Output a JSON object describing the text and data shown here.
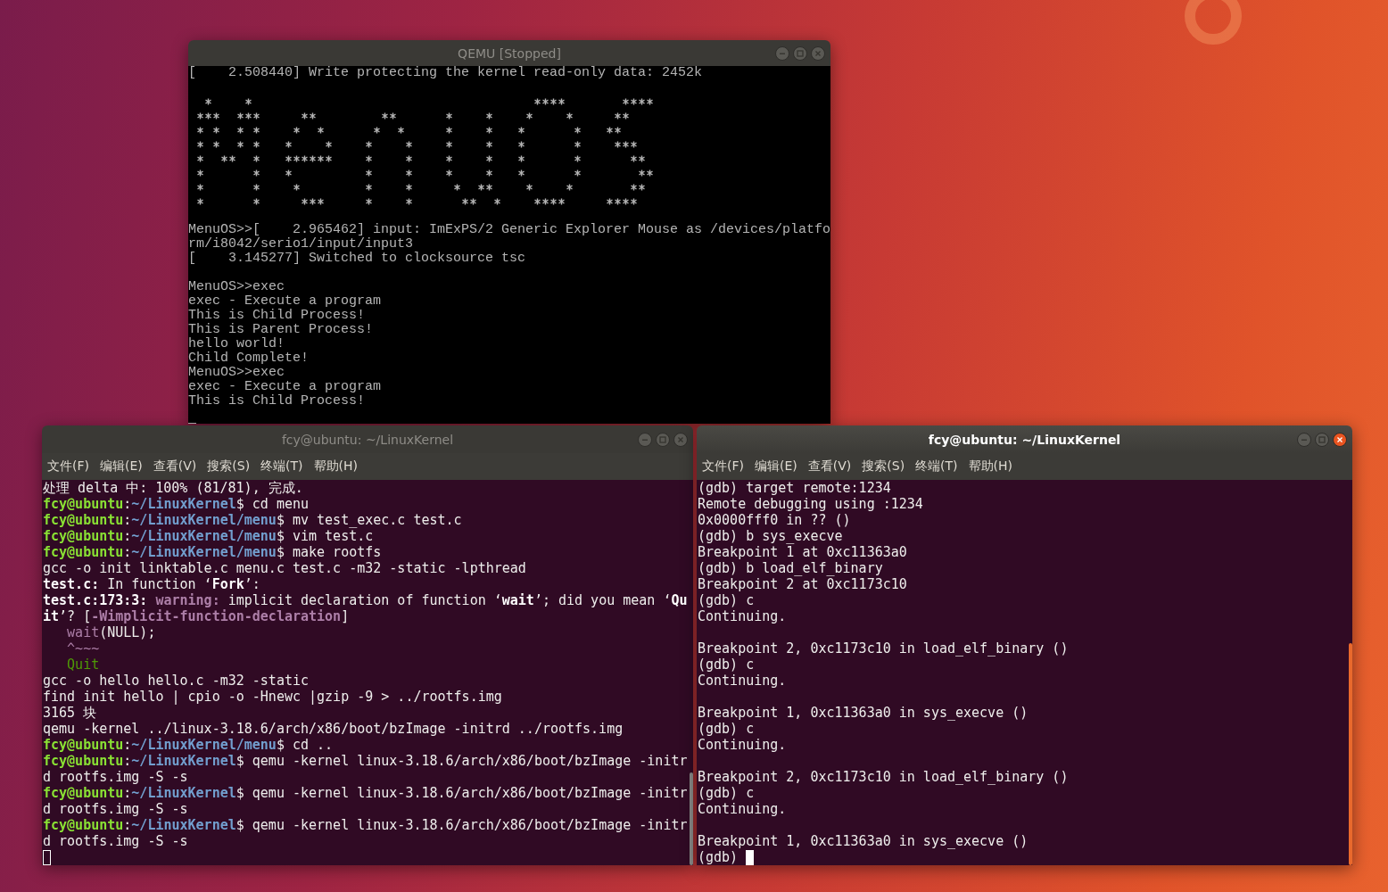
{
  "windows": [
    {
      "kind": "qemu",
      "title": "QEMU [Stopped]",
      "active": false,
      "cursor": true,
      "banner": true,
      "blocks": [
        [
          "[    2.508440] Write protecting the kernel read-only data: 2452k"
        ],
        [
          "MenuOS>>[    2.965462] input: ImExPS/2 Generic Explorer Mouse as /devices/platfo",
          "rm/i8042/serio1/input/input3",
          "[    3.145277] Switched to clocksource tsc"
        ],
        [
          "MenuOS>>exec",
          "exec - Execute a program",
          "This is Child Process!",
          "This is Parent Process!",
          "hello world!",
          "Child Complete!",
          "MenuOS>>exec",
          "exec - Execute a program",
          "This is Child Process!"
        ]
      ]
    },
    {
      "kind": "terminal",
      "title": "fcy@ubuntu: ~/LinuxKernel",
      "active": false,
      "menu": [
        "文件(F)",
        "编辑(E)",
        "查看(V)",
        "搜索(S)",
        "终端(T)",
        "帮助(H)"
      ],
      "blocks": [
        [
          {
            "spans": [
              {
                "kind": "plain",
                "text": "处理 delta 中: 100% (81/81), 完成."
              }
            ]
          },
          {
            "spans": [
              {
                "kind": "user",
                "text": "fcy@ubuntu"
              },
              {
                "kind": "plain",
                "text": ":"
              },
              {
                "kind": "path",
                "text": "~/LinuxKernel"
              },
              {
                "kind": "plain",
                "text": "$ cd menu"
              }
            ]
          },
          {
            "spans": [
              {
                "kind": "user",
                "text": "fcy@ubuntu"
              },
              {
                "kind": "plain",
                "text": ":"
              },
              {
                "kind": "path",
                "text": "~/LinuxKernel/menu"
              },
              {
                "kind": "plain",
                "text": "$ mv test_exec.c test.c"
              }
            ]
          },
          {
            "spans": [
              {
                "kind": "user",
                "text": "fcy@ubuntu"
              },
              {
                "kind": "plain",
                "text": ":"
              },
              {
                "kind": "path",
                "text": "~/LinuxKernel/menu"
              },
              {
                "kind": "plain",
                "text": "$ vim test.c"
              }
            ]
          },
          {
            "spans": [
              {
                "kind": "user",
                "text": "fcy@ubuntu"
              },
              {
                "kind": "plain",
                "text": ":"
              },
              {
                "kind": "path",
                "text": "~/LinuxKernel/menu"
              },
              {
                "kind": "plain",
                "text": "$ make rootfs"
              }
            ]
          },
          {
            "spans": [
              {
                "kind": "plain",
                "text": "gcc -o init linktable.c menu.c test.c -m32 -static -lpthread"
              }
            ]
          },
          {
            "spans": [
              {
                "kind": "bold",
                "text": "test.c:"
              },
              {
                "kind": "plain",
                "text": " In function ‘"
              },
              {
                "kind": "bold",
                "text": "Fork"
              },
              {
                "kind": "plain",
                "text": "’:"
              }
            ]
          },
          {
            "spans": [
              {
                "kind": "bold",
                "text": "test.c:173:3: "
              },
              {
                "kind": "warning",
                "text": "warning:"
              },
              {
                "kind": "plain",
                "text": " implicit declaration of function ‘"
              },
              {
                "kind": "bold",
                "text": "wait"
              },
              {
                "kind": "plain",
                "text": "’; did you mean ‘"
              },
              {
                "kind": "bold",
                "text": "Qu"
              }
            ]
          },
          {
            "spans": [
              {
                "kind": "bold",
                "text": "it"
              },
              {
                "kind": "plain",
                "text": "’? ["
              },
              {
                "kind": "warning",
                "text": "-Wimplicit-function-declaration"
              },
              {
                "kind": "plain",
                "text": "]"
              }
            ]
          },
          {
            "indent": true,
            "spans": [
              {
                "kind": "mark",
                "text": "wait"
              },
              {
                "kind": "plain",
                "text": "(NULL);"
              }
            ]
          },
          {
            "indent": true,
            "spans": [
              {
                "kind": "mark",
                "text": "^~~~"
              }
            ]
          },
          {
            "indent": true,
            "spans": [
              {
                "kind": "note",
                "text": "Quit"
              }
            ]
          },
          {
            "spans": [
              {
                "kind": "plain",
                "text": "gcc -o hello hello.c -m32 -static"
              }
            ]
          },
          {
            "spans": [
              {
                "kind": "plain",
                "text": "find init hello | cpio -o -Hnewc |gzip -9 > ../rootfs.img"
              }
            ]
          },
          {
            "spans": [
              {
                "kind": "plain",
                "text": "3165 块"
              }
            ]
          },
          {
            "spans": [
              {
                "kind": "plain",
                "text": "qemu -kernel ../linux-3.18.6/arch/x86/boot/bzImage -initrd ../rootfs.img"
              }
            ]
          },
          {
            "spans": [
              {
                "kind": "user",
                "text": "fcy@ubuntu"
              },
              {
                "kind": "plain",
                "text": ":"
              },
              {
                "kind": "path",
                "text": "~/LinuxKernel/menu"
              },
              {
                "kind": "plain",
                "text": "$ cd .."
              }
            ]
          },
          {
            "spans": [
              {
                "kind": "user",
                "text": "fcy@ubuntu"
              },
              {
                "kind": "plain",
                "text": ":"
              },
              {
                "kind": "path",
                "text": "~/LinuxKernel"
              },
              {
                "kind": "plain",
                "text": "$ qemu -kernel linux-3.18.6/arch/x86/boot/bzImage -initr"
              }
            ]
          },
          {
            "spans": [
              {
                "kind": "plain",
                "text": "d rootfs.img -S -s"
              }
            ]
          },
          {
            "spans": [
              {
                "kind": "user",
                "text": "fcy@ubuntu"
              },
              {
                "kind": "plain",
                "text": ":"
              },
              {
                "kind": "path",
                "text": "~/LinuxKernel"
              },
              {
                "kind": "plain",
                "text": "$ qemu -kernel linux-3.18.6/arch/x86/boot/bzImage -initr"
              }
            ]
          },
          {
            "spans": [
              {
                "kind": "plain",
                "text": "d rootfs.img -S -s"
              }
            ]
          },
          {
            "spans": [
              {
                "kind": "user",
                "text": "fcy@ubuntu"
              },
              {
                "kind": "plain",
                "text": ":"
              },
              {
                "kind": "path",
                "text": "~/LinuxKernel"
              },
              {
                "kind": "plain",
                "text": "$ qemu -kernel linux-3.18.6/arch/x86/boot/bzImage -initr"
              }
            ]
          },
          {
            "spans": [
              {
                "kind": "plain",
                "text": "d rootfs.img -S -s"
              }
            ]
          },
          {
            "cursor": true
          }
        ]
      ]
    },
    {
      "kind": "terminal",
      "title": "fcy@ubuntu: ~/LinuxKernel",
      "active": true,
      "menu": [
        "文件(F)",
        "编辑(E)",
        "查看(V)",
        "搜索(S)",
        "终端(T)",
        "帮助(H)"
      ],
      "blocks": [
        [
          {
            "spans": [
              {
                "kind": "plain",
                "text": "(gdb) target remote:1234"
              }
            ]
          },
          {
            "spans": [
              {
                "kind": "plain",
                "text": "Remote debugging using :1234"
              }
            ]
          },
          {
            "spans": [
              {
                "kind": "plain",
                "text": "0x0000fff0 in ?? ()"
              }
            ]
          },
          {
            "spans": [
              {
                "kind": "plain",
                "text": "(gdb) b sys_execve"
              }
            ]
          },
          {
            "spans": [
              {
                "kind": "plain",
                "text": "Breakpoint 1 at 0xc11363a0"
              }
            ]
          },
          {
            "spans": [
              {
                "kind": "plain",
                "text": "(gdb) b load_elf_binary"
              }
            ]
          },
          {
            "spans": [
              {
                "kind": "plain",
                "text": "Breakpoint 2 at 0xc1173c10"
              }
            ]
          },
          {
            "spans": [
              {
                "kind": "plain",
                "text": "(gdb) c"
              }
            ]
          },
          {
            "spans": [
              {
                "kind": "plain",
                "text": "Continuing."
              }
            ]
          }
        ],
        [
          {
            "spans": [
              {
                "kind": "plain",
                "text": "Breakpoint 2, 0xc1173c10 in load_elf_binary ()"
              }
            ]
          },
          {
            "spans": [
              {
                "kind": "plain",
                "text": "(gdb) c"
              }
            ]
          },
          {
            "spans": [
              {
                "kind": "plain",
                "text": "Continuing."
              }
            ]
          }
        ],
        [
          {
            "spans": [
              {
                "kind": "plain",
                "text": "Breakpoint 1, 0xc11363a0 in sys_execve ()"
              }
            ]
          },
          {
            "spans": [
              {
                "kind": "plain",
                "text": "(gdb) c"
              }
            ]
          },
          {
            "spans": [
              {
                "kind": "plain",
                "text": "Continuing."
              }
            ]
          }
        ],
        [
          {
            "spans": [
              {
                "kind": "plain",
                "text": "Breakpoint 2, 0xc1173c10 in load_elf_binary ()"
              }
            ]
          },
          {
            "spans": [
              {
                "kind": "plain",
                "text": "(gdb) c"
              }
            ]
          },
          {
            "spans": [
              {
                "kind": "plain",
                "text": "Continuing."
              }
            ]
          }
        ],
        [
          {
            "spans": [
              {
                "kind": "plain",
                "text": "Breakpoint 1, 0xc11363a0 in sys_execve ()"
              }
            ]
          },
          {
            "cursor": true,
            "spans": [
              {
                "kind": "plain",
                "text": "(gdb)"
              }
            ]
          }
        ]
      ]
    }
  ]
}
